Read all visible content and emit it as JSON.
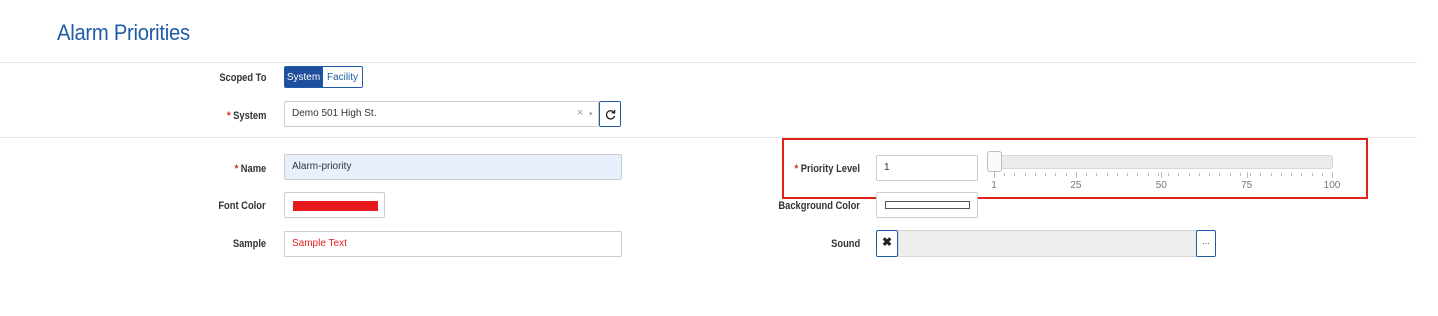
{
  "page": {
    "title": "Alarm Priorities"
  },
  "scope": {
    "label": "Scoped To",
    "options": [
      "System",
      "Facility"
    ],
    "selected": "System"
  },
  "system": {
    "required_mark": "*",
    "label": "System",
    "value": "Demo 501 High St.",
    "clear_glyph": "×",
    "caret_glyph": "▾",
    "refresh_icon": "refresh-icon"
  },
  "name": {
    "required_mark": "*",
    "label": "Name",
    "value": "Alarm-priority"
  },
  "font_color": {
    "label": "Font Color",
    "color": "#e8191c"
  },
  "sample": {
    "label": "Sample",
    "text": "Sample Text",
    "color": "#e8191c"
  },
  "priority": {
    "required_mark": "*",
    "label": "Priority Level",
    "value": "1",
    "slider_min": 1,
    "slider_max": 100,
    "slider_value": 1,
    "tick_labels": [
      "1",
      "25",
      "50",
      "75",
      "100"
    ]
  },
  "background_color": {
    "label": "Background Color",
    "color": "#ffffff"
  },
  "sound": {
    "label": "Sound",
    "clear_glyph": "✖",
    "browse_glyph": "...",
    "value": ""
  },
  "colors": {
    "accent": "#1f5ca8",
    "required": "#d9231c",
    "highlight": "#e0221b"
  }
}
